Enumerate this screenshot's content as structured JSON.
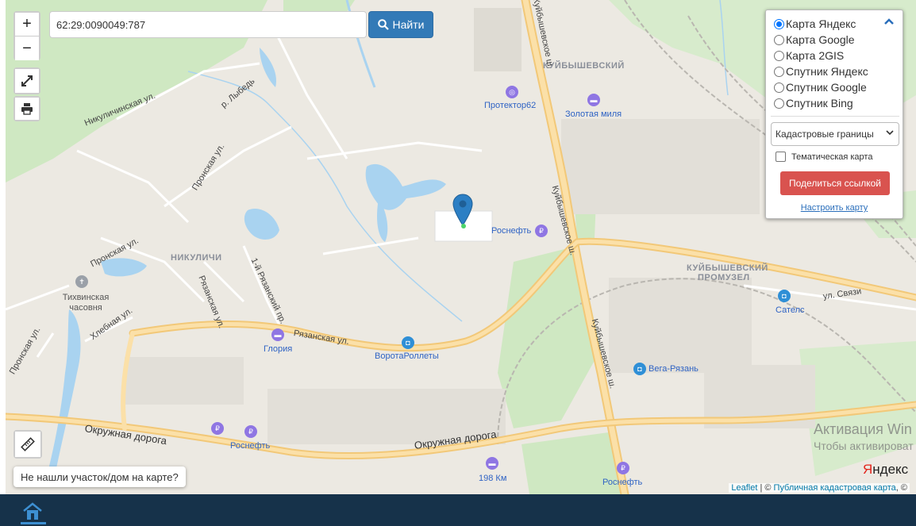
{
  "search": {
    "value": "62:29:0090049:787",
    "button_label": "Найти"
  },
  "controls": {
    "zoom_in": "+",
    "zoom_out": "−"
  },
  "layers": {
    "basemaps": [
      {
        "label": "Карта Яндекс",
        "selected": true
      },
      {
        "label": "Карта Google",
        "selected": false
      },
      {
        "label": "Карта 2GIS",
        "selected": false
      },
      {
        "label": "Спутник Яндекс",
        "selected": false
      },
      {
        "label": "Спутник Google",
        "selected": false
      },
      {
        "label": "Спутник Bing",
        "selected": false
      }
    ],
    "overlay_select": "Кадастровые границы",
    "thematic_label": "Тематическая карта",
    "thematic_checked": false,
    "share_button": "Поделиться ссылкой",
    "configure_link": "Настроить карту"
  },
  "map_labels": {
    "districts": [
      "КУЙБЫШЕВСКИЙ",
      "НИКУЛИЧИ",
      "КУЙБЫШЕВСКИЙ",
      "ПРОМУЗЕЛ"
    ],
    "streets": [
      "Куйбышевское ш.",
      "Никуличинская ул.",
      "р. Лыбедь",
      "Пронская ул.",
      "Рязанская ул.",
      "1-й Рязанский пр.",
      "Рязанская ул.",
      "Пронская ул.",
      "Хлебная ул.",
      "Пронская ул.",
      "Куйбышевское ш.",
      "Куйбышевское ш.",
      "ул. Связи",
      "Окружная дорога",
      "Окружная дорога"
    ],
    "pois": [
      "Протектор62",
      "Золотая миля",
      "Роснефть",
      "Тихвинская часовня",
      "Глория",
      "ВоротаРоллеты",
      "Сателс",
      "Вега-Рязань",
      "Роснефть",
      "198 Км",
      "Роснефть"
    ]
  },
  "notfound_button": "Не нашли участок/дом на карте?",
  "attribution": {
    "leaflet": "Leaflet",
    "sep": " | © ",
    "pkk": "Публичная кадастровая карта",
    "tail": ", ©"
  },
  "yandex_logo": "Яндекс",
  "windows_activation": {
    "title": "Активация Win",
    "subtitle": "Чтобы активироват"
  },
  "colors": {
    "accent": "#337ab7",
    "danger": "#d9534f",
    "marker": "#2c7fc4",
    "taskbar": "#16324a"
  },
  "icons": {
    "search": "search-icon",
    "fullscreen": "fullscreen-icon",
    "print": "printer-icon",
    "ruler": "ruler-icon",
    "marker": "map-marker-icon",
    "home": "home-icon",
    "collapse": "chevron-up-icon"
  }
}
